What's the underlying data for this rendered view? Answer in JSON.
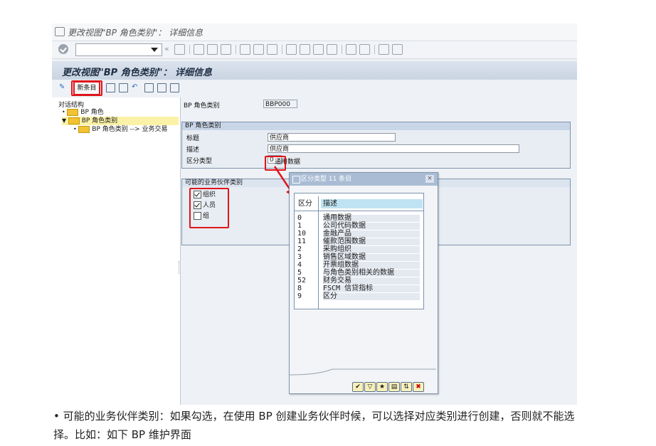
{
  "window": {
    "title": "更改视图\"BP 角色类别\"： 详细信息"
  },
  "toolbar": {
    "separator": "«"
  },
  "header": {
    "title": "更改视图\"BP 角色类别\"： 详细信息"
  },
  "app_toolbar": {
    "new_entries_label": "新条目"
  },
  "tree": {
    "header": "对话结构",
    "items": [
      {
        "label": "BP 角色"
      },
      {
        "label": "BP 角色类别"
      },
      {
        "label": "BP 角色类别 --> 业务交易"
      }
    ]
  },
  "form": {
    "role_category_label": "BP 角色类别",
    "role_category_value": "BBP000",
    "group_title": "BP 角色类别",
    "title_label": "标题",
    "title_value": "供应商",
    "description_label": "描述",
    "description_value": "供应商",
    "diff_type_label": "区分类型",
    "diff_type_value": "0",
    "diff_type_text": "通用数据",
    "partner_group_title": "可能的业务伙伴类别",
    "partner_options": [
      {
        "label": "组织",
        "checked": true
      },
      {
        "label": "人员",
        "checked": true
      },
      {
        "label": "组",
        "checked": false
      }
    ]
  },
  "popup": {
    "title": "区分类型 11 条目",
    "close": "×",
    "col_key": "区分",
    "col_desc": "描述",
    "rows": [
      {
        "key": "0",
        "desc": "通用数据"
      },
      {
        "key": "1",
        "desc": "公司代码数据"
      },
      {
        "key": "10",
        "desc": "金融产品"
      },
      {
        "key": "11",
        "desc": "催款范围数据"
      },
      {
        "key": "2",
        "desc": "采购组织"
      },
      {
        "key": "3",
        "desc": "销售区域数据"
      },
      {
        "key": "4",
        "desc": "开票组数据"
      },
      {
        "key": "5",
        "desc": "与角色类别相关的数据"
      },
      {
        "key": "52",
        "desc": "财务交易"
      },
      {
        "key": "8",
        "desc": "FSCM 信贷指标"
      },
      {
        "key": "9",
        "desc": "区分"
      }
    ]
  },
  "caption": {
    "bullet": "•",
    "text": "可能的业务伙伴类别：如果勾选，在使用 BP 创建业务伙伴时候，可以选择对应类别进行创建，否则就不能选择。比如：如下 BP 维护界面"
  },
  "colors": {
    "highlight": "#e0141b",
    "header_bg": "#c9d4e2",
    "popup_title_bg": "#a9bcd4"
  }
}
